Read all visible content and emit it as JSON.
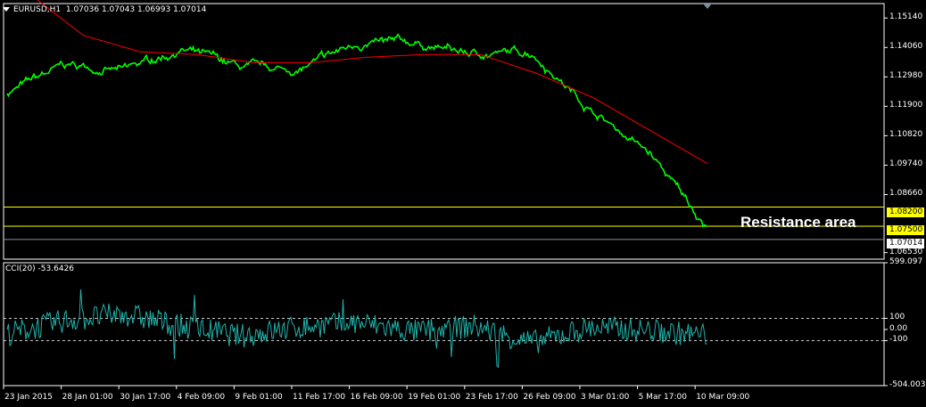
{
  "header": {
    "symbol": "EURUSD,H1",
    "ohlc": "1.07036 1.07043 1.06993 1.07014"
  },
  "cci_header": "CCI(20) -53.6426",
  "annotation": "Resistance area",
  "colors": {
    "price": "#00ff00",
    "ma": "#ff0000",
    "cci": "#20b2aa",
    "zone": "#ffff00",
    "axes": "#ffffff",
    "background": "#000000"
  },
  "price_axis": {
    "ticks": [
      "1.15140",
      "1.14060",
      "1.12980",
      "1.11900",
      "1.10820",
      "1.09740",
      "1.08660",
      "1.06530"
    ]
  },
  "zone_lines": [
    {
      "label": "1.08200",
      "value": 1.082
    },
    {
      "label": "1.07500",
      "value": 1.075
    }
  ],
  "current_price": {
    "label": "1.07014",
    "value": 1.07014
  },
  "cci_axis": {
    "ticks": [
      "599.097",
      "100",
      "0.00",
      "-100",
      "-504.003"
    ],
    "max": 599.097,
    "min": -504.003,
    "levels": [
      100,
      -100
    ]
  },
  "x_axis": {
    "labels": [
      "23 Jan 2015",
      "28 Jan 01:00",
      "30 Jan 17:00",
      "4 Feb 09:00",
      "9 Feb 01:00",
      "11 Feb 17:00",
      "16 Feb 09:00",
      "19 Feb 01:00",
      "23 Feb 17:00",
      "26 Feb 09:00",
      "3 Mar 01:00",
      "5 Mar 17:00",
      "10 Mar 09:00"
    ]
  },
  "chart_data": {
    "type": "line",
    "price_ylim": [
      1.0629,
      1.1567
    ],
    "x": [
      "23 Jan 2015",
      "28 Jan 01:00",
      "30 Jan 17:00",
      "4 Feb 09:00",
      "9 Feb 01:00",
      "11 Feb 17:00",
      "16 Feb 09:00",
      "19 Feb 01:00",
      "23 Feb 17:00",
      "26 Feb 09:00",
      "3 Mar 01:00",
      "5 Mar 17:00",
      "10 Mar 09:00"
    ],
    "series": [
      {
        "name": "EURUSD,H1",
        "values": [
          1.124,
          1.134,
          1.132,
          1.14,
          1.133,
          1.132,
          1.142,
          1.142,
          1.138,
          1.139,
          1.118,
          1.102,
          1.075
        ]
      },
      {
        "name": "",
        "values": [
          1.161,
          1.145,
          1.139,
          1.138,
          1.135,
          1.135,
          1.137,
          1.138,
          1.138,
          1.131,
          1.122,
          1.11,
          1.098
        ]
      },
      {
        "name": "CCI(20)",
        "values": [
          -40,
          80,
          140,
          30,
          -60,
          20,
          60,
          -20,
          30,
          -120,
          20,
          -10,
          -54
        ]
      }
    ]
  }
}
